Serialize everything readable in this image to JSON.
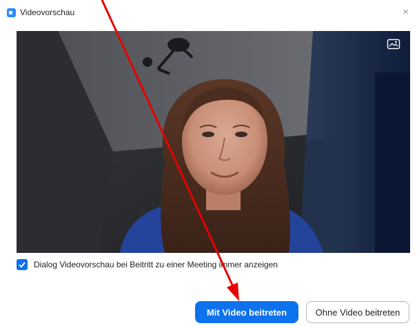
{
  "window": {
    "title": "Videovorschau",
    "close_glyph": "×"
  },
  "icons": {
    "app": "zoom-app-icon",
    "close": "close-icon",
    "fullscreen": "fullscreen-icon",
    "check": "checkmark-icon"
  },
  "video": {
    "description_hidden": false,
    "fullscreen_icon": "fullscreen-icon"
  },
  "options": {
    "always_show_preview_checked": true,
    "always_show_preview_label": "Dialog Videovorschau bei Beitritt zu einer Meeting immer anzeigen"
  },
  "buttons": {
    "join_with_video": "Mit Video beitreten",
    "join_without_video": "Ohne Video beitreten"
  },
  "colors": {
    "primary": "#0e72ed",
    "annotation_arrow": "#e60000"
  }
}
